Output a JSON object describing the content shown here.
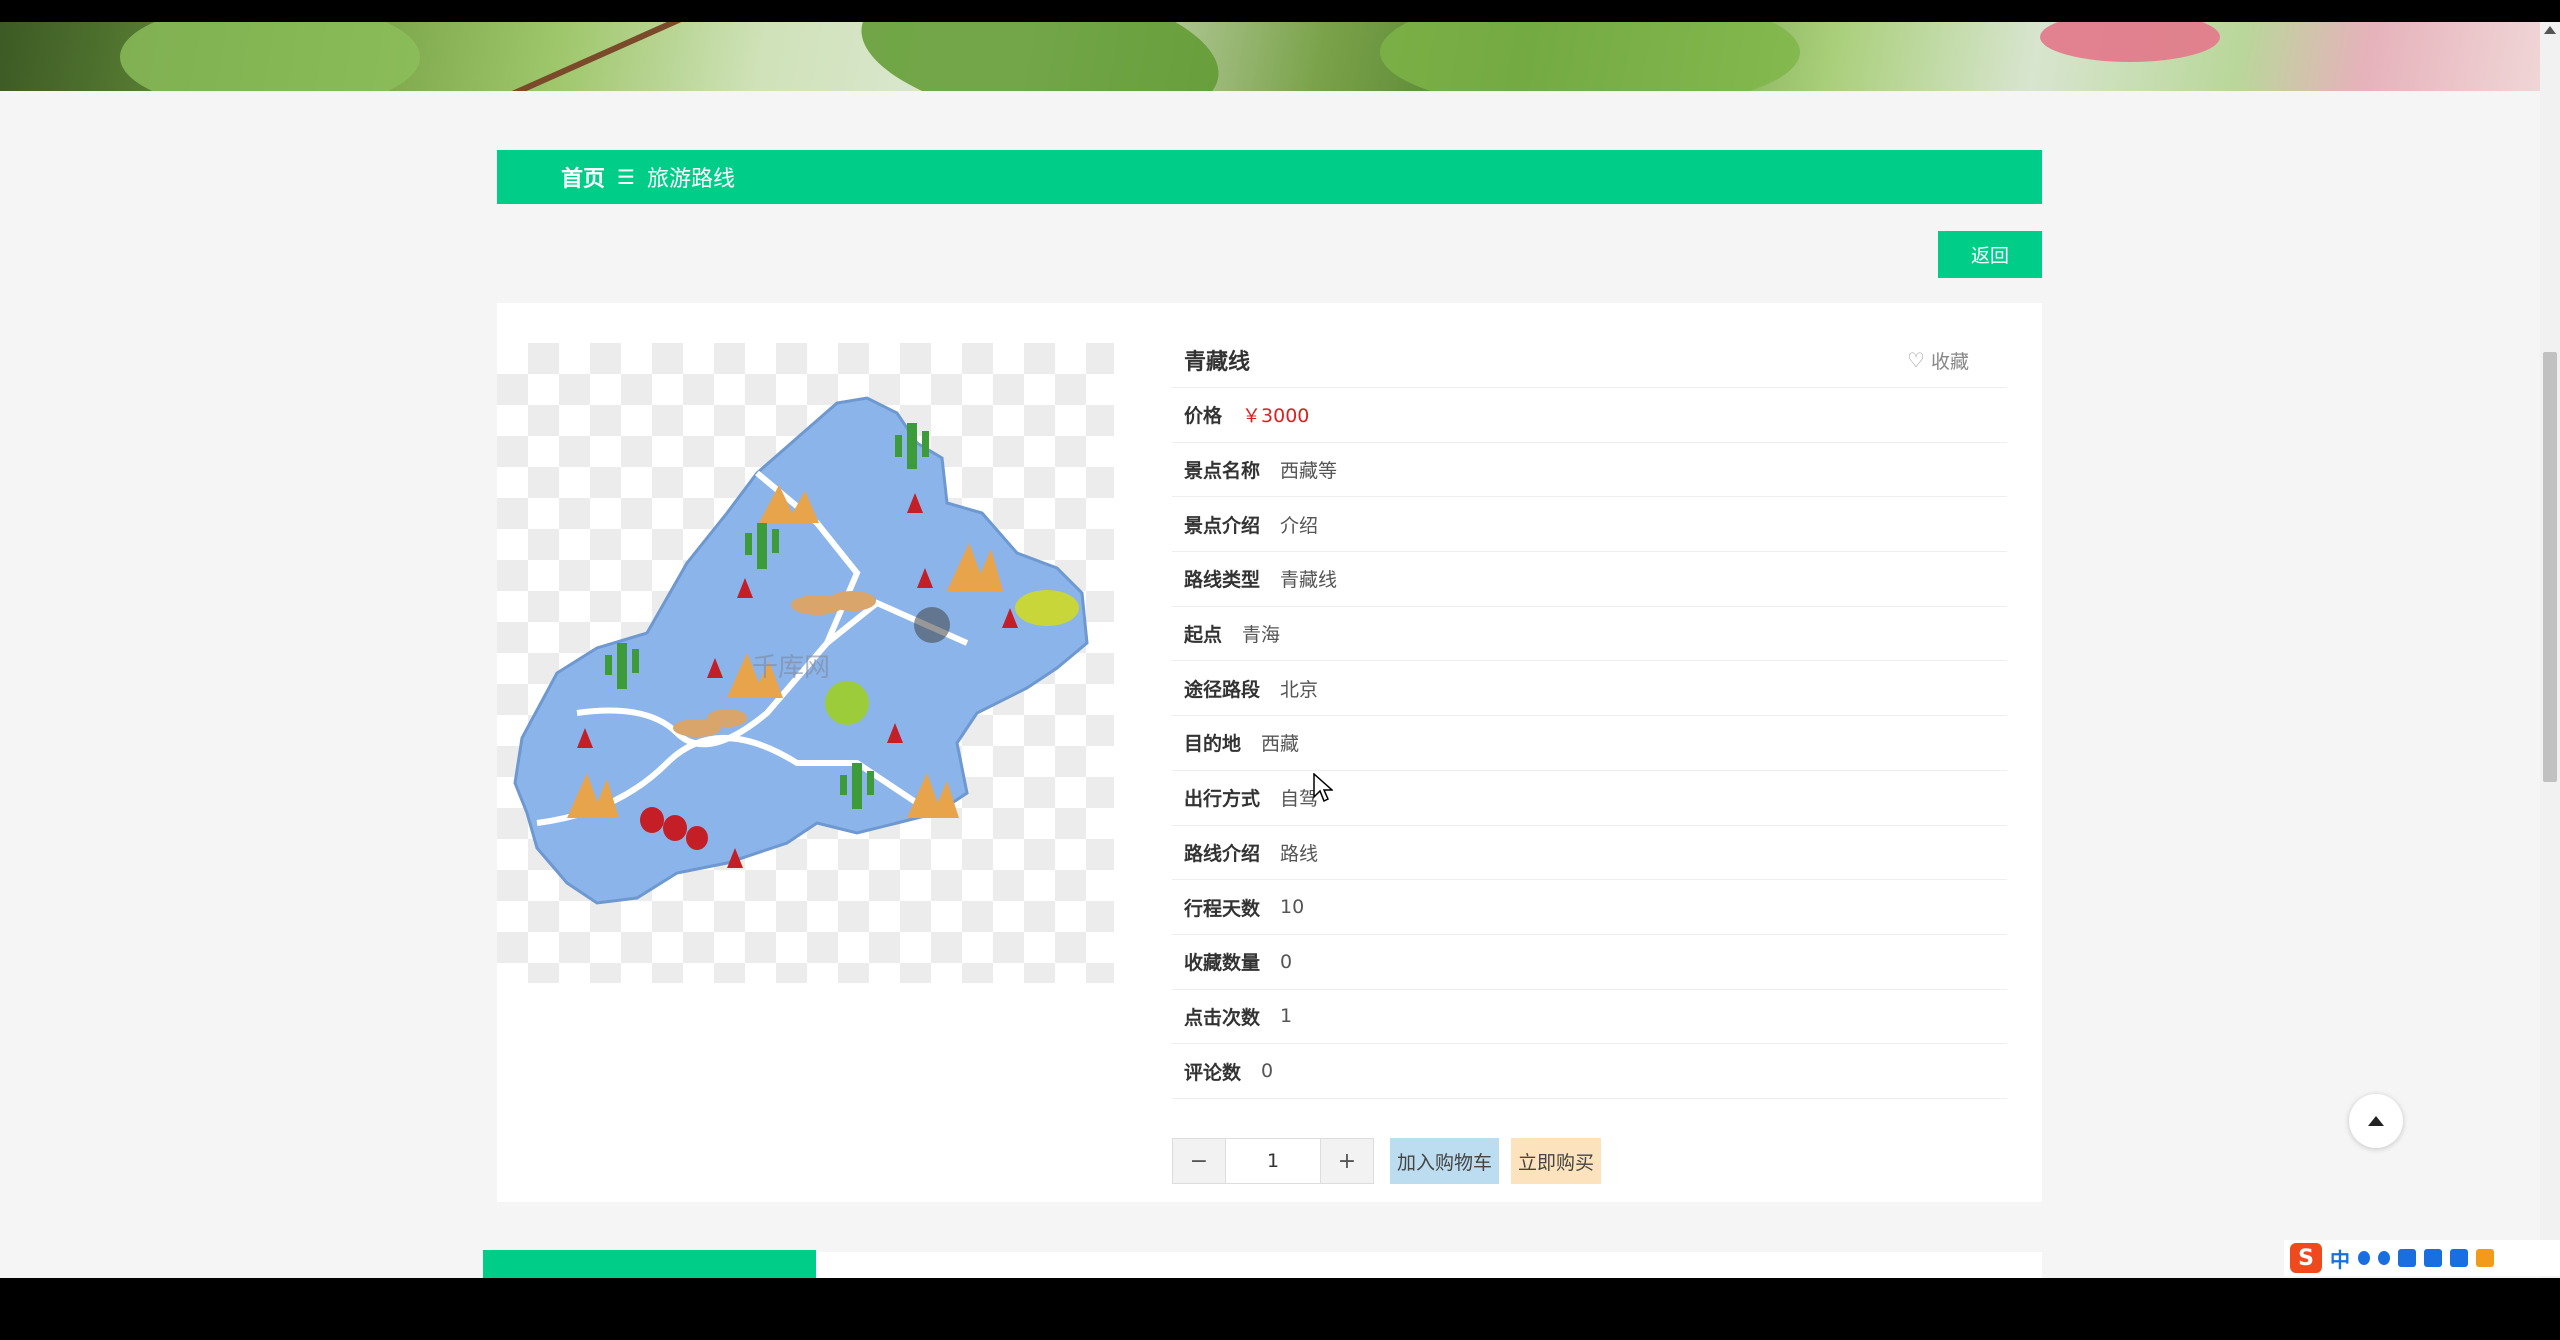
{
  "breadcrumb": {
    "home": "首页",
    "separator": "☰",
    "current": "旅游路线"
  },
  "back_button": "返回",
  "route": {
    "name": "青藏线",
    "favorite_label": "收藏",
    "fields": [
      {
        "label": "价格",
        "value": "￥3000",
        "is_price": true
      },
      {
        "label": "景点名称",
        "value": "西藏等"
      },
      {
        "label": "景点介绍",
        "value": "介绍"
      },
      {
        "label": "路线类型",
        "value": "青藏线"
      },
      {
        "label": "起点",
        "value": "青海"
      },
      {
        "label": "途径路段",
        "value": "北京"
      },
      {
        "label": "目的地",
        "value": "西藏"
      },
      {
        "label": "出行方式",
        "value": "自驾"
      },
      {
        "label": "路线介绍",
        "value": "路线"
      },
      {
        "label": "行程天数",
        "value": "10"
      },
      {
        "label": "收藏数量",
        "value": "0"
      },
      {
        "label": "点击次数",
        "value": "1"
      },
      {
        "label": "评论数",
        "value": "0"
      }
    ]
  },
  "purchase": {
    "minus": "−",
    "plus": "+",
    "quantity": "1",
    "add_to_cart": "加入购物车",
    "buy_now": "立即购买"
  },
  "image_watermark": "千库网",
  "ime": {
    "zh": "中"
  },
  "colors": {
    "accent": "#00cd87",
    "price": "#e02020",
    "cart_button": "#bcdcf0",
    "buy_button": "#fde3bd",
    "map_fill": "#8ab4ea"
  },
  "icons": [
    "heart-icon",
    "chevron-up-icon",
    "menu-separator-icon",
    "mouse-cursor-icon",
    "sogou-ime-icon"
  ]
}
